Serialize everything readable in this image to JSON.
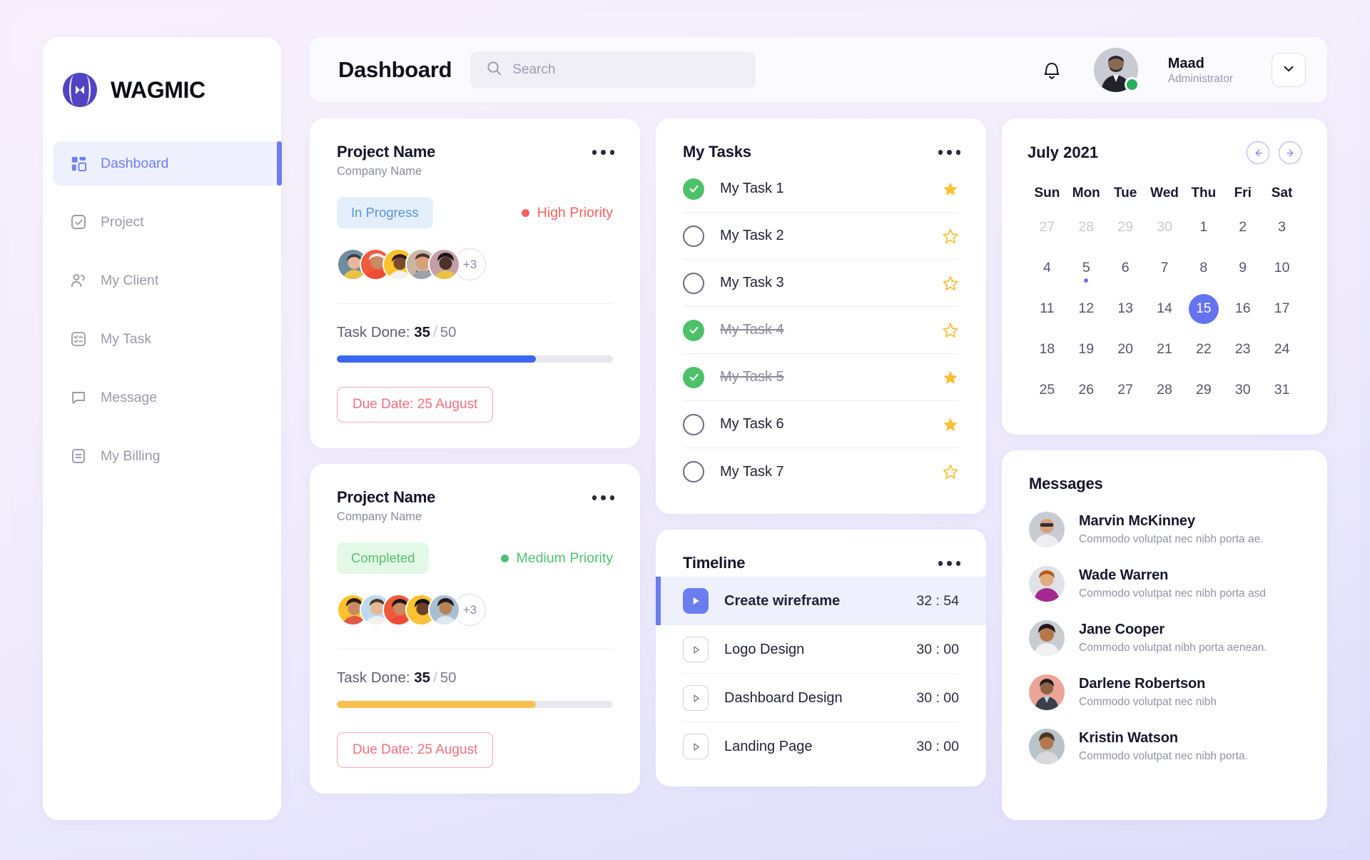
{
  "brand": {
    "name": "WAGMIC"
  },
  "sidebar": {
    "items": [
      {
        "label": "Dashboard",
        "icon": "grid-icon",
        "active": true
      },
      {
        "label": "Project",
        "icon": "check-square-icon",
        "active": false
      },
      {
        "label": "My Client",
        "icon": "users-icon",
        "active": false
      },
      {
        "label": "My Task",
        "icon": "task-list-icon",
        "active": false
      },
      {
        "label": "Message",
        "icon": "chat-bubble-icon",
        "active": false
      },
      {
        "label": "My Billing",
        "icon": "billing-icon",
        "active": false
      }
    ]
  },
  "topbar": {
    "title": "Dashboard",
    "search_placeholder": "Search",
    "search_value": "",
    "user_name": "Maad",
    "user_role": "Administrator",
    "status": "online"
  },
  "projects": [
    {
      "name": "Project Name",
      "company": "Company Name",
      "status": "In Progress",
      "status_type": "progress",
      "priority": "High Priority",
      "priority_type": "high",
      "extra_members": "+3",
      "task_done_label": "Task Done:",
      "task_done": "35",
      "task_total": "50",
      "progress_pct": 72,
      "progress_color": "#3b68ef",
      "due": "Due Date: 25 August"
    },
    {
      "name": "Project Name",
      "company": "Company Name",
      "status": "Completed",
      "status_type": "completed",
      "priority": "Medium Priority",
      "priority_type": "medium",
      "extra_members": "+3",
      "task_done_label": "Task Done:",
      "task_done": "35",
      "task_total": "50",
      "progress_pct": 72,
      "progress_color": "#fac04e",
      "due": "Due Date: 25 August"
    }
  ],
  "tasks": {
    "title": "My Tasks",
    "items": [
      {
        "label": "My Task  1",
        "checked": true,
        "starred": true
      },
      {
        "label": "My Task  2",
        "checked": false,
        "starred": false
      },
      {
        "label": "My Task  3",
        "checked": false,
        "starred": false
      },
      {
        "label": "My Task  4",
        "checked": true,
        "starred": false
      },
      {
        "label": "My Task  5",
        "checked": true,
        "starred": true
      },
      {
        "label": "My Task  6",
        "checked": false,
        "starred": true
      },
      {
        "label": "My Task  7",
        "checked": false,
        "starred": false
      }
    ]
  },
  "timeline": {
    "title": "Timeline",
    "items": [
      {
        "label": "Create wireframe",
        "time": "32 : 54",
        "active": true
      },
      {
        "label": "Logo Design",
        "time": "30 : 00",
        "active": false
      },
      {
        "label": "Dashboard Design",
        "time": "30 : 00",
        "active": false
      },
      {
        "label": "Landing Page",
        "time": "30 : 00",
        "active": false
      }
    ]
  },
  "calendar": {
    "title": "July 2021",
    "dow": [
      "Sun",
      "Mon",
      "Tue",
      "Wed",
      "Thu",
      "Fri",
      "Sat"
    ],
    "selected": 15,
    "event_days": [
      5
    ],
    "weeks": [
      [
        {
          "d": "27",
          "muted": true
        },
        {
          "d": "28",
          "muted": true
        },
        {
          "d": "29",
          "muted": true
        },
        {
          "d": "30",
          "muted": true
        },
        {
          "d": "1"
        },
        {
          "d": "2"
        },
        {
          "d": "3"
        }
      ],
      [
        {
          "d": "4"
        },
        {
          "d": "5"
        },
        {
          "d": "6"
        },
        {
          "d": "7"
        },
        {
          "d": "8"
        },
        {
          "d": "9"
        },
        {
          "d": "10"
        }
      ],
      [
        {
          "d": "11"
        },
        {
          "d": "12"
        },
        {
          "d": "13"
        },
        {
          "d": "14"
        },
        {
          "d": "15"
        },
        {
          "d": "16"
        },
        {
          "d": "17"
        }
      ],
      [
        {
          "d": "18"
        },
        {
          "d": "19"
        },
        {
          "d": "20"
        },
        {
          "d": "21"
        },
        {
          "d": "22"
        },
        {
          "d": "23"
        },
        {
          "d": "24"
        }
      ],
      [
        {
          "d": "25"
        },
        {
          "d": "26"
        },
        {
          "d": "27"
        },
        {
          "d": "28"
        },
        {
          "d": "29"
        },
        {
          "d": "30"
        },
        {
          "d": "31"
        }
      ]
    ]
  },
  "messages": {
    "title": "Messages",
    "items": [
      {
        "name": "Marvin McKinney",
        "text": "Commodo volutpat nec nibh porta ae."
      },
      {
        "name": "Wade Warren",
        "text": "Commodo volutpat nec nibh porta  asd"
      },
      {
        "name": "Jane Cooper",
        "text": "Commodo volutpat  nibh porta aenean."
      },
      {
        "name": "Darlene Robertson",
        "text": "Commodo volutpat nec nibh"
      },
      {
        "name": "Kristin Watson",
        "text": "Commodo volutpat nec nibh porta."
      }
    ]
  },
  "colors": {
    "accent": "#6c7df0",
    "progress_blue": "#3b68ef",
    "progress_amber": "#fac04e",
    "danger": "#f4707c",
    "success": "#4cc16a",
    "star": "#fbbf33"
  }
}
